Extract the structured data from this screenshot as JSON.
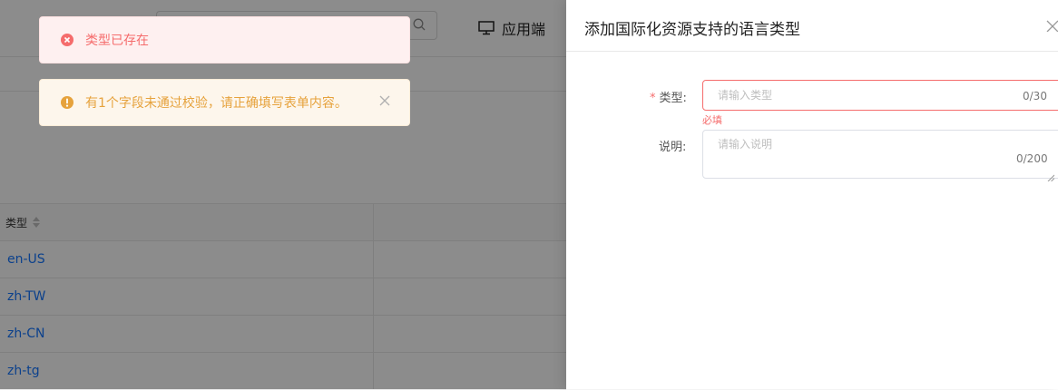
{
  "background": {
    "header": {
      "app_switch_label": "应用端"
    },
    "table": {
      "column_type": "类型",
      "rows": [
        "en-US",
        "zh-TW",
        "zh-CN",
        "zh-tg"
      ]
    }
  },
  "toasts": {
    "error_text": "类型已存在",
    "warning_text": "有1个字段未通过校验，请正确填写表单内容。"
  },
  "drawer": {
    "title": "添加国际化资源支持的语言类型",
    "form": {
      "type_label": "类型:",
      "type_required_mark": "*",
      "type_placeholder": "请输入类型",
      "type_counter": "0/30",
      "type_error": "必填",
      "desc_label": "说明:",
      "desc_placeholder": "请输入说明",
      "desc_counter": "0/200"
    }
  },
  "colors": {
    "error": "#f56c6c",
    "warning": "#e6a23c",
    "link": "#1677ff"
  }
}
